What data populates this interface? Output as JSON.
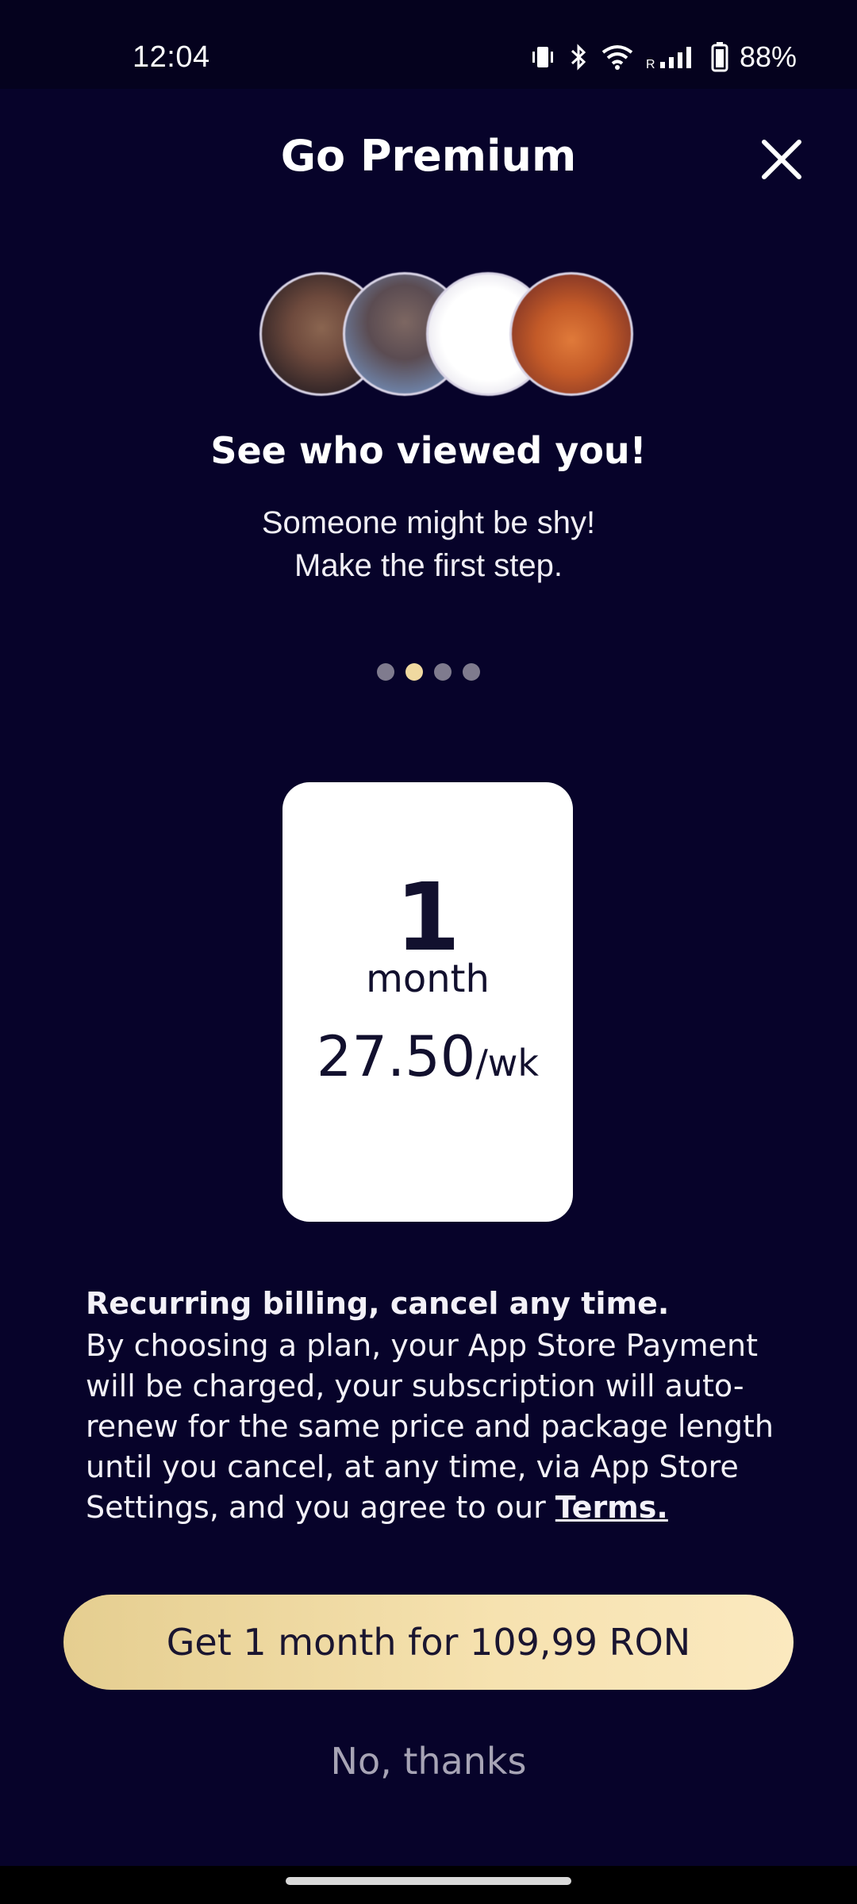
{
  "status_bar": {
    "time": "12:04",
    "battery": "88%",
    "icons": [
      "vibrate-icon",
      "bluetooth-icon",
      "wifi-icon",
      "signal-icon",
      "battery-icon"
    ],
    "roaming": "R"
  },
  "header": {
    "title": "Go Premium",
    "close_icon": "close-icon"
  },
  "feature": {
    "title": "See who viewed you!",
    "line1": "Someone might be shy!",
    "line2": "Make the first step.",
    "carousel_pages": 4,
    "carousel_active": 2
  },
  "plan": {
    "number": "1",
    "unit": "month",
    "price": "27.50",
    "per": "/wk"
  },
  "billing": {
    "heading": "Recurring billing, cancel any time.",
    "body": "By choosing a plan, your App Store Payment will be charged, your subscription will auto-renew for the same price and package length until you cancel, at any time, via App Store Settings, and you agree to our ",
    "terms_link": "Terms."
  },
  "actions": {
    "cta_label": "Get 1 month for 109,99 RON",
    "decline_label": "No, thanks"
  },
  "colors": {
    "background": "#07032a",
    "accent_gold": "#f0d9a0",
    "card": "#ffffff"
  }
}
